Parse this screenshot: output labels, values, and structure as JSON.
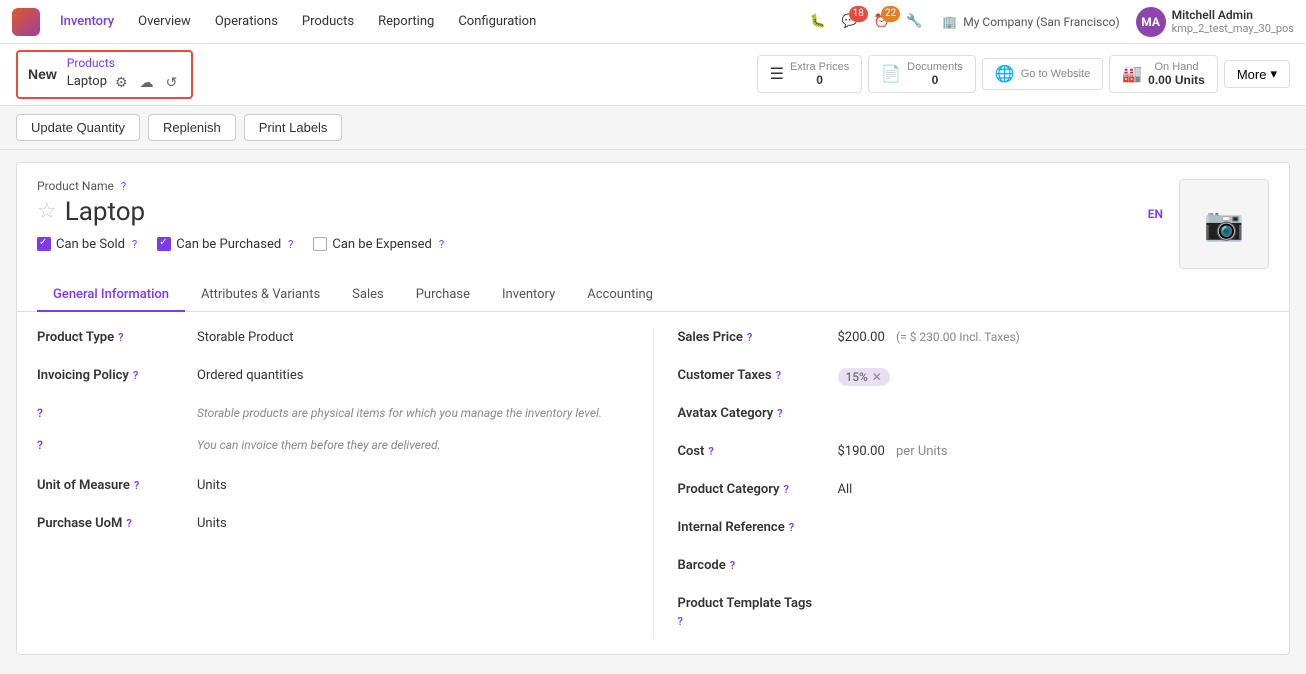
{
  "app": {
    "logo_label": "Odoo",
    "nav_items": [
      "Inventory",
      "Overview",
      "Operations",
      "Products",
      "Reporting",
      "Configuration"
    ],
    "active_nav": "Inventory"
  },
  "topbar": {
    "bug_icon": "🐛",
    "messages_count": "18",
    "tasks_count": "22",
    "wrench_icon": "🔧",
    "company": "My Company (San Francisco)",
    "user_name": "Mitchell Admin",
    "user_sub": "kmp_2_test_may_30_pos",
    "user_initials": "MA"
  },
  "toolbar": {
    "new_label": "New",
    "breadcrumb_parent": "Products",
    "breadcrumb_current": "Laptop",
    "extra_prices_label": "Extra Prices",
    "extra_prices_count": "0",
    "documents_label": "Documents",
    "documents_count": "0",
    "go_to_website_label": "Go to Website",
    "on_hand_label": "On Hand",
    "on_hand_value": "0.00 Units",
    "more_label": "More"
  },
  "action_bar": {
    "update_qty_label": "Update Quantity",
    "replenish_label": "Replenish",
    "print_labels_label": "Print Labels"
  },
  "product": {
    "name_field_label": "Product Name",
    "name_value": "Laptop",
    "lang_btn": "EN",
    "can_be_sold_label": "Can be Sold",
    "can_be_sold_checked": true,
    "can_be_purchased_label": "Can be Purchased",
    "can_be_purchased_checked": true,
    "can_be_expensed_label": "Can be Expensed",
    "can_be_expensed_checked": false
  },
  "tabs": [
    {
      "id": "general",
      "label": "General Information",
      "active": true
    },
    {
      "id": "attributes",
      "label": "Attributes & Variants",
      "active": false
    },
    {
      "id": "sales",
      "label": "Sales",
      "active": false
    },
    {
      "id": "purchase",
      "label": "Purchase",
      "active": false
    },
    {
      "id": "inventory",
      "label": "Inventory",
      "active": false
    },
    {
      "id": "accounting",
      "label": "Accounting",
      "active": false
    }
  ],
  "general_info": {
    "left": {
      "product_type_label": "Product Type",
      "product_type_value": "Storable Product",
      "invoicing_policy_label": "Invoicing Policy",
      "invoicing_policy_value": "Ordered quantities",
      "note1": "Storable products are physical items for which you manage the inventory level.",
      "note2": "You can invoice them before they are delivered.",
      "uom_label": "Unit of Measure",
      "uom_value": "Units",
      "purchase_uom_label": "Purchase UoM",
      "purchase_uom_value": "Units"
    },
    "right": {
      "sales_price_label": "Sales Price",
      "sales_price_value": "$200.00",
      "incl_taxes": "(= $ 230.00 Incl. Taxes)",
      "customer_taxes_label": "Customer Taxes",
      "customer_taxes_tag": "15%",
      "avatax_label": "Avatax Category",
      "avatax_value": "",
      "cost_label": "Cost",
      "cost_value": "$190.00",
      "cost_unit": "per Units",
      "product_category_label": "Product Category",
      "product_category_value": "All",
      "internal_ref_label": "Internal Reference",
      "internal_ref_value": "",
      "barcode_label": "Barcode",
      "barcode_value": "",
      "tags_label": "Product Template Tags",
      "tags_value": ""
    }
  }
}
